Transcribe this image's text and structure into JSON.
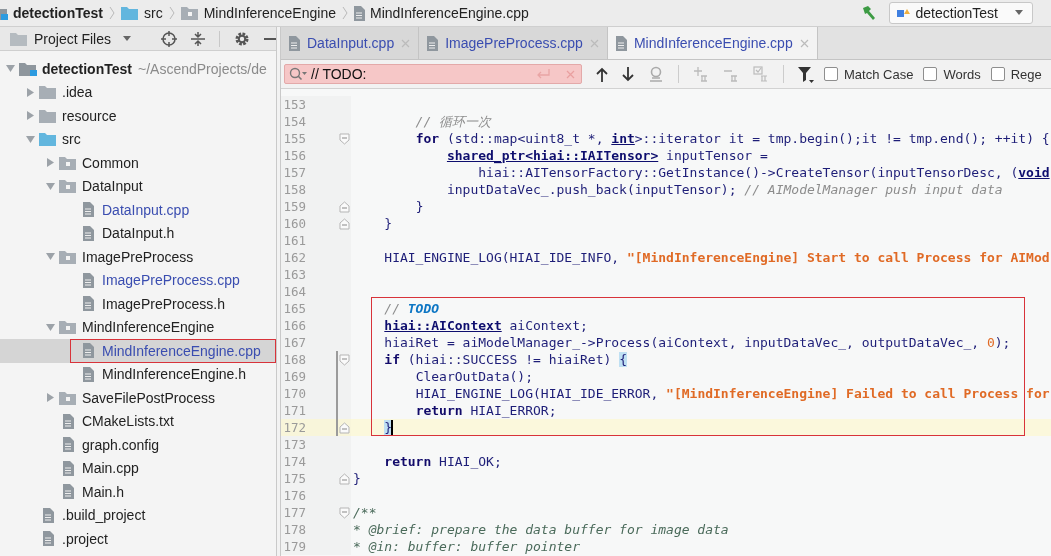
{
  "breadcrumbs": [
    {
      "label": "detectionTest",
      "kind": "project"
    },
    {
      "label": "src",
      "kind": "source_root"
    },
    {
      "label": "MindInferenceEngine",
      "kind": "package"
    },
    {
      "label": "MindInferenceEngine.cpp",
      "kind": "file"
    }
  ],
  "run_config": {
    "label": "detectionTest"
  },
  "project_panel": {
    "title": "Project Files",
    "tree": [
      {
        "label": "detectionTest",
        "kind": "project",
        "path": "~/AscendProjects/de",
        "expanded": true,
        "selected": false,
        "open": false,
        "framed": false,
        "children": [
          {
            "label": ".idea",
            "kind": "folder",
            "expanded": false,
            "selected": false,
            "open": false,
            "framed": false
          },
          {
            "label": "resource",
            "kind": "folder",
            "expanded": false,
            "selected": false,
            "open": false,
            "framed": false
          },
          {
            "label": "src",
            "kind": "source_root",
            "expanded": true,
            "selected": false,
            "open": false,
            "framed": false,
            "children": [
              {
                "label": "Common",
                "kind": "package",
                "expanded": false,
                "selected": false,
                "open": false,
                "framed": false
              },
              {
                "label": "DataInput",
                "kind": "package",
                "expanded": true,
                "selected": false,
                "open": false,
                "framed": false,
                "children": [
                  {
                    "label": "DataInput.cpp",
                    "kind": "file",
                    "selected": false,
                    "open": true,
                    "framed": false
                  },
                  {
                    "label": "DataInput.h",
                    "kind": "file",
                    "selected": false,
                    "open": false,
                    "framed": false
                  }
                ]
              },
              {
                "label": "ImagePreProcess",
                "kind": "package",
                "expanded": true,
                "selected": false,
                "open": false,
                "framed": false,
                "children": [
                  {
                    "label": "ImagePreProcess.cpp",
                    "kind": "file",
                    "selected": false,
                    "open": true,
                    "framed": false
                  },
                  {
                    "label": "ImagePreProcess.h",
                    "kind": "file",
                    "selected": false,
                    "open": false,
                    "framed": false
                  }
                ]
              },
              {
                "label": "MindInferenceEngine",
                "kind": "package",
                "expanded": true,
                "selected": false,
                "open": false,
                "framed": false,
                "children": [
                  {
                    "label": "MindInferenceEngine.cpp",
                    "kind": "file",
                    "selected": true,
                    "open": true,
                    "framed": true
                  },
                  {
                    "label": "MindInferenceEngine.h",
                    "kind": "file",
                    "selected": false,
                    "open": false,
                    "framed": false
                  }
                ]
              },
              {
                "label": "SaveFilePostProcess",
                "kind": "package",
                "expanded": false,
                "selected": false,
                "open": false,
                "framed": false
              },
              {
                "label": "CMakeLists.txt",
                "kind": "file",
                "selected": false,
                "open": false,
                "framed": false
              },
              {
                "label": "graph.config",
                "kind": "file",
                "selected": false,
                "open": false,
                "framed": false
              },
              {
                "label": "Main.cpp",
                "kind": "file",
                "selected": false,
                "open": false,
                "framed": false
              },
              {
                "label": "Main.h",
                "kind": "file",
                "selected": false,
                "open": false,
                "framed": false
              }
            ]
          },
          {
            "label": ".build_project",
            "kind": "file",
            "selected": false,
            "open": false,
            "framed": false
          },
          {
            "label": ".project",
            "kind": "file",
            "selected": false,
            "open": false,
            "framed": false
          }
        ]
      }
    ]
  },
  "tabs": [
    {
      "label": "DataInput.cpp",
      "selected": false
    },
    {
      "label": "ImagePreProcess.cpp",
      "selected": false
    },
    {
      "label": "MindInferenceEngine.cpp",
      "selected": true
    }
  ],
  "search": {
    "value": "// TODO:",
    "options": [
      {
        "label": "Match Case",
        "checked": false
      },
      {
        "label": "Words",
        "checked": false
      },
      {
        "label": "Rege",
        "checked": false
      }
    ]
  },
  "code": {
    "blocks": [
      {
        "framed": false,
        "lines": [
          {
            "number": "153",
            "fold_start": false,
            "fold_end": false,
            "changed": false,
            "current": false
          },
          {
            "number": "154",
            "fold_start": false,
            "fold_end": false,
            "changed": false,
            "current": false,
            "tokens": [
              {
                "text": "        // 循环一次",
                "kind": "comment"
              }
            ]
          },
          {
            "number": "155",
            "fold_start": true,
            "fold_end": false,
            "changed": false,
            "current": false,
            "tokens": [
              {
                "text": "        for",
                "kind": "keyword"
              },
              {
                "text": " (std::map<uint8_t *, ",
                "kind": "plain"
              },
              {
                "text": "int",
                "kind": "type"
              },
              {
                "text": ">::iterator it = tmp.begin();it != tmp.end(); ++it) {",
                "kind": "plain"
              }
            ]
          },
          {
            "number": "156",
            "fold_start": false,
            "fold_end": false,
            "changed": false,
            "current": false,
            "tokens": [
              {
                "text": "            shared_ptr<hiai::IAITensor>",
                "kind": "type"
              },
              {
                "text": " inputTensor =",
                "kind": "plain"
              }
            ]
          },
          {
            "number": "157",
            "fold_start": false,
            "fold_end": false,
            "changed": false,
            "current": false,
            "tokens": [
              {
                "text": "                hiai::AITensorFactory::GetInstance()->CreateTensor(inputTensorDesc, (",
                "kind": "plain"
              },
              {
                "text": "void",
                "kind": "type"
              }
            ]
          },
          {
            "number": "158",
            "fold_start": false,
            "fold_end": false,
            "changed": false,
            "current": false,
            "tokens": [
              {
                "text": "            inputDataVec_.push_back(inputTensor); ",
                "kind": "plain"
              },
              {
                "text": "// AIModelManager push input data",
                "kind": "comment"
              }
            ]
          },
          {
            "number": "159",
            "fold_start": false,
            "fold_end": true,
            "changed": false,
            "current": false,
            "tokens": [
              {
                "text": "        }",
                "kind": "plain"
              }
            ]
          },
          {
            "number": "160",
            "fold_start": false,
            "fold_end": true,
            "changed": false,
            "current": false,
            "tokens": [
              {
                "text": "    }",
                "kind": "plain"
              }
            ]
          },
          {
            "number": "161",
            "fold_start": false,
            "fold_end": false,
            "changed": false,
            "current": false
          },
          {
            "number": "162",
            "fold_start": false,
            "fold_end": false,
            "changed": false,
            "current": false,
            "tokens": [
              {
                "text": "    HIAI_ENGINE_LOG(HIAI_IDE_INFO, ",
                "kind": "plain"
              },
              {
                "text": "\"[MindInferenceEngine] Start to call Process for AIMod",
                "kind": "string"
              }
            ]
          },
          {
            "number": "163",
            "fold_start": false,
            "fold_end": false,
            "changed": false,
            "current": false
          },
          {
            "number": "164",
            "fold_start": false,
            "fold_end": false,
            "changed": false,
            "current": false
          }
        ]
      },
      {
        "framed": true,
        "lines": [
          {
            "number": "165",
            "fold_start": false,
            "fold_end": false,
            "changed": false,
            "current": false,
            "tokens": [
              {
                "text": "    // ",
                "kind": "comment"
              },
              {
                "text": "TODO",
                "kind": "todo"
              }
            ]
          },
          {
            "number": "166",
            "fold_start": false,
            "fold_end": false,
            "changed": false,
            "current": false,
            "tokens": [
              {
                "text": "    hiai::AIContext",
                "kind": "type"
              },
              {
                "text": " aiContext;",
                "kind": "plain"
              }
            ]
          },
          {
            "number": "167",
            "fold_start": false,
            "fold_end": false,
            "changed": false,
            "current": false,
            "tokens": [
              {
                "text": "    hiaiRet = aiModelManager_->Process(aiContext, inputDataVec_, outputDataVec_, ",
                "kind": "plain"
              },
              {
                "text": "0",
                "kind": "number"
              },
              {
                "text": ");",
                "kind": "plain"
              }
            ]
          },
          {
            "number": "168",
            "fold_start": true,
            "fold_end": false,
            "changed": true,
            "current": false,
            "tokens": [
              {
                "text": "    if",
                "kind": "keyword"
              },
              {
                "text": " (hiai::SUCCESS != hiaiRet) ",
                "kind": "plain"
              },
              {
                "text": "{",
                "kind": "brace_match"
              }
            ]
          },
          {
            "number": "169",
            "fold_start": false,
            "fold_end": false,
            "changed": true,
            "current": false,
            "tokens": [
              {
                "text": "        ClearOutData();",
                "kind": "plain"
              }
            ]
          },
          {
            "number": "170",
            "fold_start": false,
            "fold_end": false,
            "changed": true,
            "current": false,
            "tokens": [
              {
                "text": "        HIAI_ENGINE_LOG(HIAI_IDE_ERROR, ",
                "kind": "plain"
              },
              {
                "text": "\"[MindInferenceEngine] Failed to call Process for",
                "kind": "string"
              }
            ]
          },
          {
            "number": "171",
            "fold_start": false,
            "fold_end": false,
            "changed": true,
            "current": false,
            "tokens": [
              {
                "text": "        return",
                "kind": "keyword"
              },
              {
                "text": " HIAI_ERROR;",
                "kind": "plain"
              }
            ]
          },
          {
            "number": "172",
            "fold_start": false,
            "fold_end": true,
            "changed": true,
            "current": true,
            "tokens": [
              {
                "text": "    }",
                "kind": "brace_match"
              }
            ]
          }
        ]
      },
      {
        "framed": false,
        "lines": [
          {
            "number": "173",
            "fold_start": false,
            "fold_end": false,
            "changed": false,
            "current": false
          },
          {
            "number": "174",
            "fold_start": false,
            "fold_end": false,
            "changed": false,
            "current": false,
            "tokens": [
              {
                "text": "    return",
                "kind": "keyword"
              },
              {
                "text": " HIAI_OK;",
                "kind": "plain"
              }
            ]
          },
          {
            "number": "175",
            "fold_start": false,
            "fold_end": true,
            "changed": false,
            "current": false,
            "tokens": [
              {
                "text": "}",
                "kind": "plain"
              }
            ]
          },
          {
            "number": "176",
            "fold_start": false,
            "fold_end": false,
            "changed": false,
            "current": false
          },
          {
            "number": "177",
            "fold_start": true,
            "fold_end": false,
            "changed": false,
            "current": false,
            "tokens": [
              {
                "text": "/**",
                "kind": "doc"
              }
            ]
          },
          {
            "number": "178",
            "fold_start": false,
            "fold_end": false,
            "changed": false,
            "current": false,
            "tokens": [
              {
                "text": "* @brief: prepare the data buffer for image data",
                "kind": "doc"
              }
            ]
          },
          {
            "number": "179",
            "fold_start": false,
            "fold_end": false,
            "changed": false,
            "current": false,
            "tokens": [
              {
                "text": "* @in: buffer: buffer pointer",
                "kind": "doc"
              }
            ]
          }
        ]
      }
    ]
  }
}
